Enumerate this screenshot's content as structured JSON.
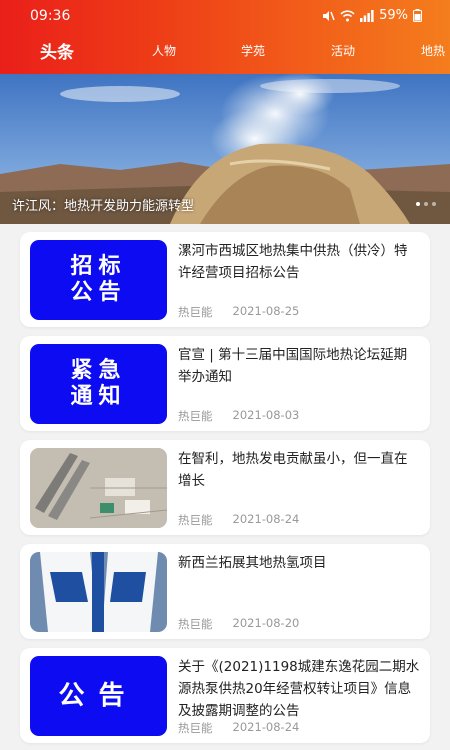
{
  "status": {
    "time": "09:36",
    "battery": "59%"
  },
  "nav": {
    "active": "头条",
    "tabs": [
      "人物",
      "学苑",
      "活动",
      "地热"
    ]
  },
  "banner": {
    "caption": "许江风：地热开发助力能源转型"
  },
  "articles": [
    {
      "thumb_lines": [
        "招标",
        "公告"
      ],
      "title": "漯河市西城区地热集中供热（供冷）特许经营项目招标公告",
      "source": "热巨能",
      "date": "2021-08-25"
    },
    {
      "thumb_lines": [
        "紧急",
        "通知"
      ],
      "title": "官宣 | 第十三届中国国际地热论坛延期举办通知",
      "source": "热巨能",
      "date": "2021-08-03"
    },
    {
      "thumb_lines": [],
      "title": "在智利，地热发电贡献虽小，但一直在增长",
      "source": "热巨能",
      "date": "2021-08-24"
    },
    {
      "thumb_lines": [],
      "title": "新西兰拓展其地热氢项目",
      "source": "热巨能",
      "date": "2021-08-20"
    },
    {
      "thumb_lines": [
        "公告"
      ],
      "title": "关于《(2021)1198城建东逸花园二期水源热泵供热20年经营权转让项目》信息及披露期调整的公告",
      "source": "热巨能",
      "date": "2021-08-24"
    }
  ],
  "colors": {
    "header_start": "#ea1f1a",
    "header_end": "#f47d1d",
    "notice_blue": "#0c0bf2"
  }
}
